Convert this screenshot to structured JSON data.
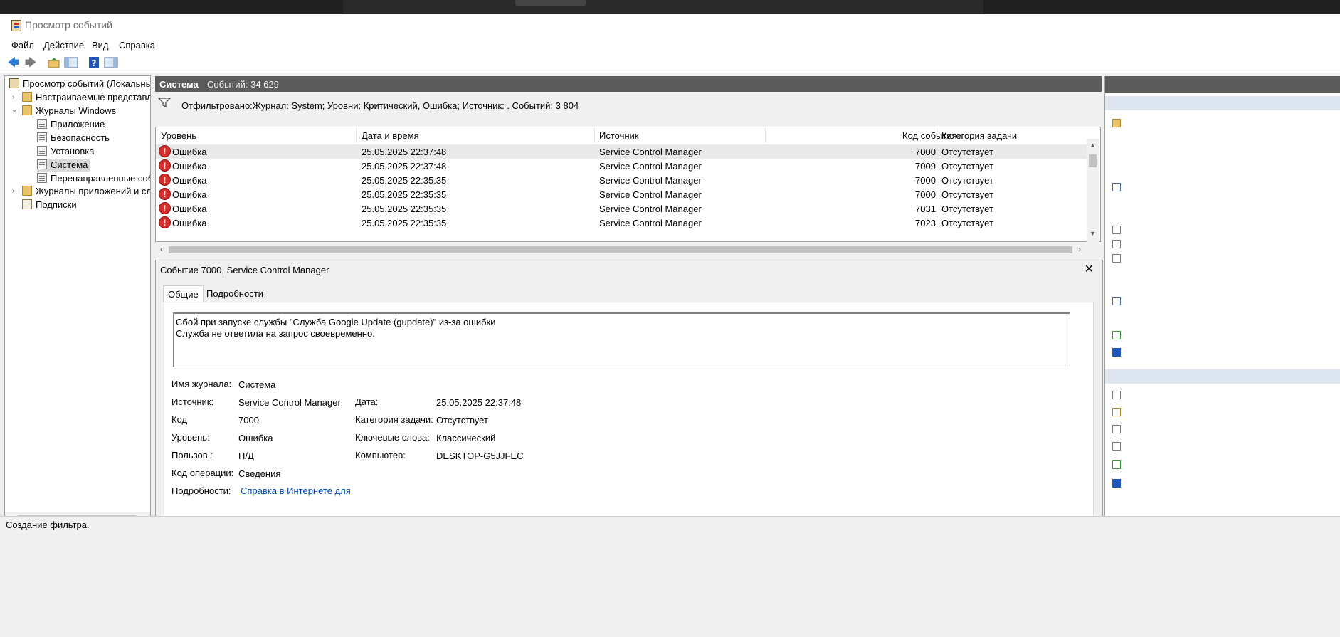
{
  "window": {
    "title": "Просмотр событий"
  },
  "menu": [
    "Файл",
    "Действие",
    "Вид",
    "Справка"
  ],
  "tree": {
    "root": "Просмотр событий (Локальный)",
    "custom_views": "Настраиваемые представления",
    "windows_logs": "Журналы Windows",
    "logs": [
      "Приложение",
      "Безопасность",
      "Установка",
      "Система",
      "Перенаправленные события"
    ],
    "app_services_logs": "Журналы приложений и служб",
    "subscriptions": "Подписки"
  },
  "header": {
    "title": "Система",
    "count": "Событий: 34 629"
  },
  "filter": {
    "text": "Отфильтровано:Журнал: System; Уровни: Критический, Ошибка; Источник: . Событий: 3 804"
  },
  "grid": {
    "columns": [
      "Уровень",
      "Дата и время",
      "Источник",
      "Код события",
      "Категория задачи"
    ],
    "rows": [
      {
        "level": "Ошибка",
        "datetime": "25.05.2025 22:37:48",
        "source": "Service Control Manager",
        "code": "7000",
        "category": "Отсутствует"
      },
      {
        "level": "Ошибка",
        "datetime": "25.05.2025 22:37:48",
        "source": "Service Control Manager",
        "code": "7009",
        "category": "Отсутствует"
      },
      {
        "level": "Ошибка",
        "datetime": "25.05.2025 22:35:35",
        "source": "Service Control Manager",
        "code": "7000",
        "category": "Отсутствует"
      },
      {
        "level": "Ошибка",
        "datetime": "25.05.2025 22:35:35",
        "source": "Service Control Manager",
        "code": "7000",
        "category": "Отсутствует"
      },
      {
        "level": "Ошибка",
        "datetime": "25.05.2025 22:35:35",
        "source": "Service Control Manager",
        "code": "7031",
        "category": "Отсутствует"
      },
      {
        "level": "Ошибка",
        "datetime": "25.05.2025 22:35:35",
        "source": "Service Control Manager",
        "code": "7023",
        "category": "Отсутствует"
      }
    ]
  },
  "detail": {
    "title": "Событие 7000, Service Control Manager",
    "tabs": [
      "Общие",
      "Подробности"
    ],
    "message_line1": "Сбой при запуске службы \"Служба Google Update (gupdate)\" из-за ошибки",
    "message_line2": "Служба не ответила на запрос своевременно.",
    "fields": {
      "log_name_label": "Имя журнала:",
      "log_name": "Система",
      "source_label": "Источник:",
      "source": "Service Control Manager",
      "date_label": "Дата:",
      "date": "25.05.2025 22:37:48",
      "code_label": "Код",
      "code": "7000",
      "category_label": "Категория задачи:",
      "category": "Отсутствует",
      "level_label": "Уровень:",
      "level": "Ошибка",
      "keywords_label": "Ключевые слова:",
      "keywords": "Классический",
      "user_label": "Пользов.:",
      "user": "Н/Д",
      "computer_label": "Компьютер:",
      "computer": "DESKTOP-G5JJFEC",
      "opcode_label": "Код операции:",
      "opcode": "Сведения",
      "more_label": "Подробности:",
      "more_link": "Справка в Интернете для"
    }
  },
  "status": {
    "text": "Создание фильтра."
  }
}
